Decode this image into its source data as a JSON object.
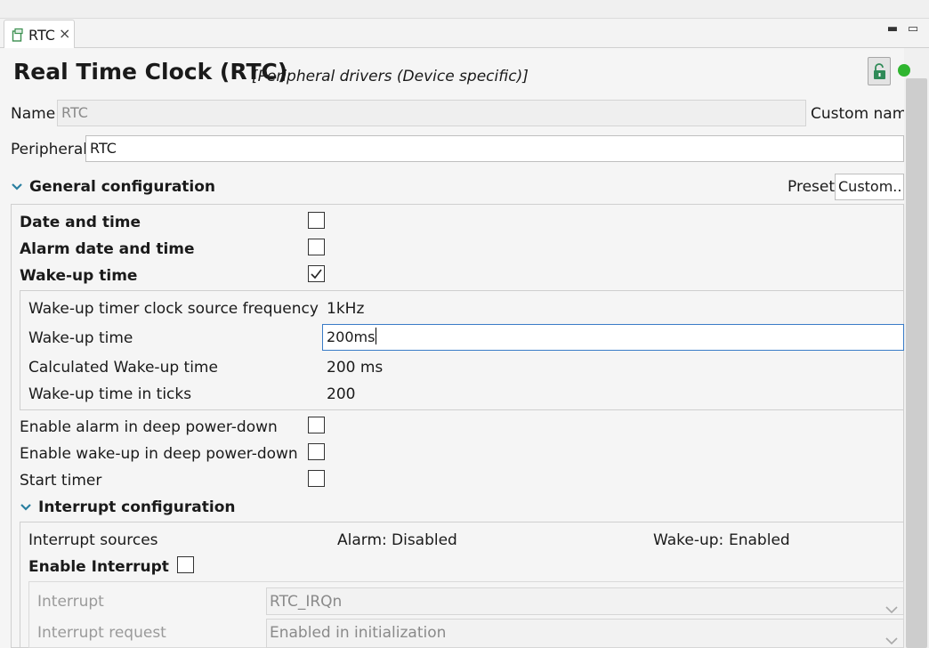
{
  "tab": {
    "label": "RTC",
    "close": "×",
    "icon": "component-icon"
  },
  "window_controls": {
    "minimize": "▬",
    "maximize": "▭"
  },
  "header": {
    "title": "Real Time Clock (RTC)",
    "subtitle": "[Peripheral drivers (Device specific)]"
  },
  "name_row": {
    "label": "Name",
    "value": "RTC",
    "custom_label": "Custom name"
  },
  "peripheral_row": {
    "label": "Peripheral",
    "value": "RTC"
  },
  "general": {
    "title": "General configuration",
    "preset_label": "Preset",
    "preset_value": "Custom...",
    "date_and_time": {
      "label": "Date and time",
      "checked": false
    },
    "alarm_date_and_time": {
      "label": "Alarm date and time",
      "checked": false
    },
    "wake_up_time": {
      "label": "Wake-up time",
      "checked": true
    },
    "wake": {
      "clock_freq_label": "Wake-up timer clock source frequency",
      "clock_freq_value": "1kHz",
      "time_label": "Wake-up time",
      "time_value": "200ms",
      "calc_label": "Calculated Wake-up time",
      "calc_value": "200 ms",
      "ticks_label": "Wake-up time in ticks",
      "ticks_value": "200"
    },
    "enable_alarm_deep": {
      "label": "Enable alarm in deep power-down",
      "checked": false
    },
    "enable_wake_deep": {
      "label": "Enable wake-up in deep power-down",
      "checked": false
    },
    "start_timer": {
      "label": "Start timer",
      "checked": false
    }
  },
  "interrupt": {
    "title": "Interrupt configuration",
    "sources_label": "Interrupt sources",
    "alarm_label": "Alarm:",
    "alarm_value": "Disabled",
    "wake_label": "Wake-up:",
    "wake_value": "Enabled",
    "enable_label": "Enable Interrupt",
    "enable_checked": false,
    "interrupt_label": "Interrupt",
    "interrupt_value": "RTC_IRQn",
    "request_label": "Interrupt request",
    "request_value": "Enabled in initialization"
  }
}
